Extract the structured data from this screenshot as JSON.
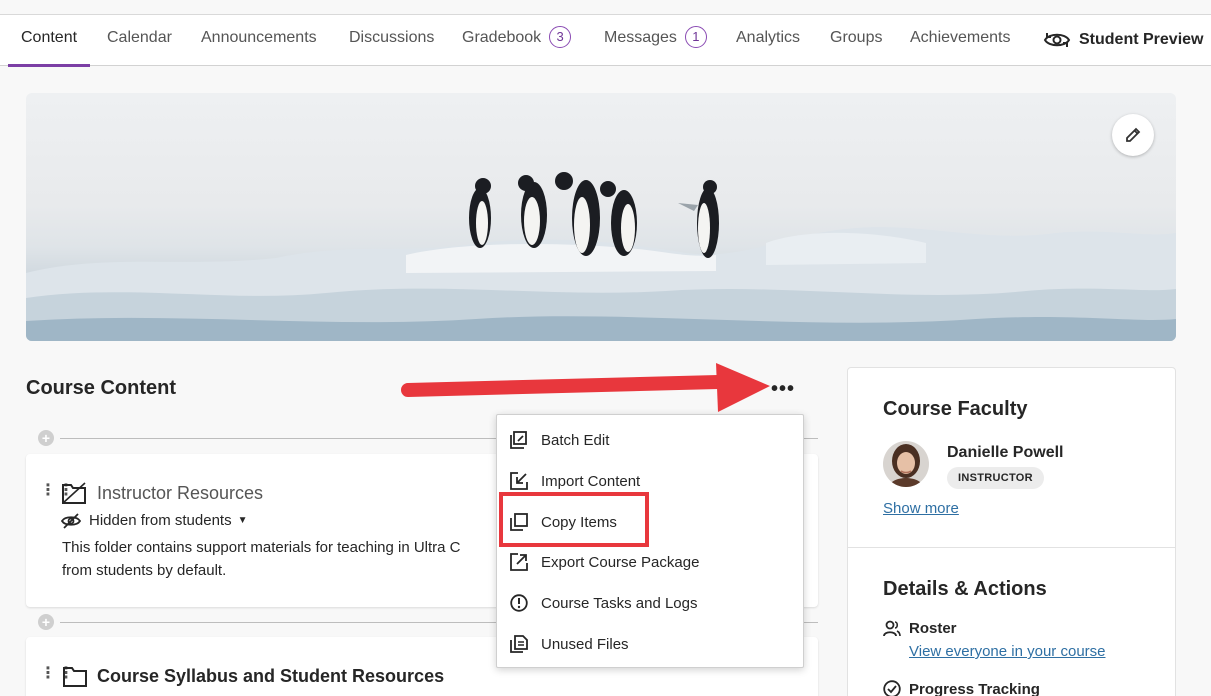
{
  "nav": {
    "tabs": [
      {
        "label": "Content"
      },
      {
        "label": "Calendar"
      },
      {
        "label": "Announcements"
      },
      {
        "label": "Discussions"
      },
      {
        "label": "Gradebook",
        "badge": "3"
      },
      {
        "label": "Messages",
        "badge": "1"
      },
      {
        "label": "Analytics"
      },
      {
        "label": "Groups"
      },
      {
        "label": "Achievements"
      }
    ],
    "active_tab": "Content",
    "student_preview": "Student Preview"
  },
  "course_content": {
    "title": "Course Content",
    "more_label": "•••",
    "items": [
      {
        "title": "Instructor Resources",
        "visibility": "Hidden from students",
        "description": "This folder contains support materials for teaching in Ultra C",
        "description_line2": "from students by default."
      },
      {
        "title": "Course Syllabus and Student Resources"
      }
    ]
  },
  "menu": {
    "items": [
      {
        "label": "Batch Edit",
        "icon": "batch-edit-icon"
      },
      {
        "label": "Import Content",
        "icon": "import-icon"
      },
      {
        "label": "Copy Items",
        "icon": "copy-icon"
      },
      {
        "label": "Export Course Package",
        "icon": "export-icon"
      },
      {
        "label": "Course Tasks and Logs",
        "icon": "alert-circle-icon"
      },
      {
        "label": "Unused Files",
        "icon": "files-icon"
      }
    ],
    "highlighted": "Copy Items"
  },
  "faculty": {
    "heading": "Course Faculty",
    "name": "Danielle Powell",
    "role": "INSTRUCTOR",
    "show_more": "Show more"
  },
  "details": {
    "heading": "Details & Actions",
    "roster_label": "Roster",
    "roster_link": "View everyone in your course",
    "progress_label": "Progress Tracking"
  },
  "colors": {
    "accent_purple": "#7c3fa5",
    "link_blue": "#2e6fa3",
    "annotation_red": "#e8373d"
  }
}
